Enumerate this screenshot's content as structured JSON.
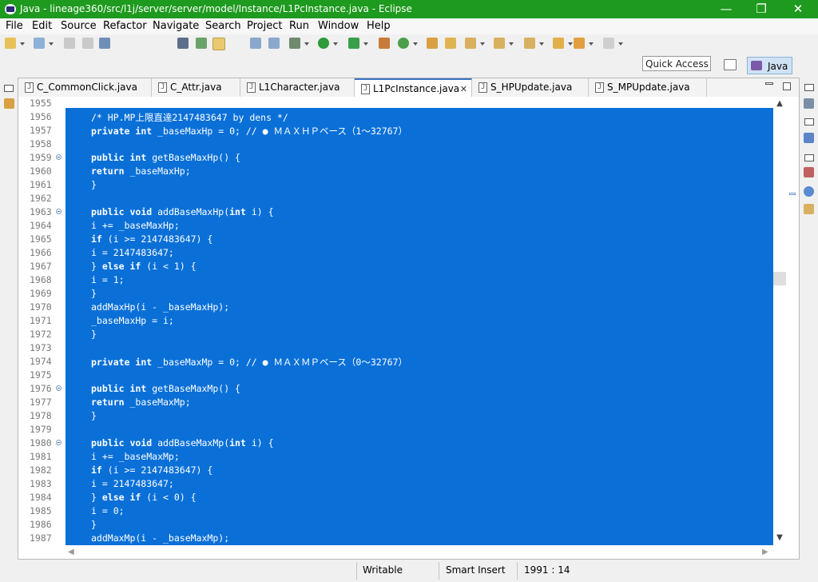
{
  "window": {
    "title": "Java - lineage360/src/l1j/server/server/model/Instance/L1PcInstance.java - Eclipse",
    "controls": [
      "—",
      "❐",
      "✕"
    ]
  },
  "menu": [
    "File",
    "Edit",
    "Source",
    "Refactor",
    "Navigate",
    "Search",
    "Project",
    "Run",
    "Window",
    "Help"
  ],
  "quick_access": {
    "placeholder": "Quick Access"
  },
  "perspective": {
    "active": "Java"
  },
  "tabs": [
    {
      "label": "C_CommonClick.java",
      "active": false
    },
    {
      "label": "C_Attr.java",
      "active": false
    },
    {
      "label": "L1Character.java",
      "active": false
    },
    {
      "label": "L1PcInstance.java",
      "active": true,
      "close": "✕"
    },
    {
      "label": "S_HPUpdate.java",
      "active": false
    },
    {
      "label": "S_MPUpdate.java",
      "active": false
    }
  ],
  "code": {
    "selection_color": "#0a70d8",
    "lines": [
      {
        "num": "1955",
        "text": ""
      },
      {
        "num": "1956",
        "text": "/* HP.MP上限直達2147483647 by dens */"
      },
      {
        "num": "1957",
        "text": "private int _baseMaxHp = 0; // ● ＭＡＸＨＰベース（1～32767）"
      },
      {
        "num": "1958",
        "text": ""
      },
      {
        "num": "1959",
        "text": "public int getBaseMaxHp() {"
      },
      {
        "num": "1960",
        "text": "return _baseMaxHp;"
      },
      {
        "num": "1961",
        "text": "}"
      },
      {
        "num": "1962",
        "text": ""
      },
      {
        "num": "1963",
        "text": "public void addBaseMaxHp(int i) {"
      },
      {
        "num": "1964",
        "text": "i += _baseMaxHp;"
      },
      {
        "num": "1965",
        "text": "if (i >= 2147483647) {"
      },
      {
        "num": "1966",
        "text": "i = 2147483647;"
      },
      {
        "num": "1967",
        "text": "} else if (i < 1) {"
      },
      {
        "num": "1968",
        "text": "i = 1;"
      },
      {
        "num": "1969",
        "text": "}"
      },
      {
        "num": "1970",
        "text": "addMaxHp(i - _baseMaxHp);"
      },
      {
        "num": "1971",
        "text": "_baseMaxHp = i;"
      },
      {
        "num": "1972",
        "text": "}"
      },
      {
        "num": "1973",
        "text": ""
      },
      {
        "num": "1974",
        "text": "private int _baseMaxMp = 0; // ● ＭＡＸＭＰベース（0～32767）"
      },
      {
        "num": "1975",
        "text": ""
      },
      {
        "num": "1976",
        "text": "public int getBaseMaxMp() {"
      },
      {
        "num": "1977",
        "text": "return _baseMaxMp;"
      },
      {
        "num": "1978",
        "text": "}"
      },
      {
        "num": "1979",
        "text": ""
      },
      {
        "num": "1980",
        "text": "public void addBaseMaxMp(int i) {"
      },
      {
        "num": "1981",
        "text": "i += _baseMaxMp;"
      },
      {
        "num": "1982",
        "text": "if (i >= 2147483647) {"
      },
      {
        "num": "1983",
        "text": "i = 2147483647;"
      },
      {
        "num": "1984",
        "text": "} else if (i < 0) {"
      },
      {
        "num": "1985",
        "text": "i = 0;"
      },
      {
        "num": "1986",
        "text": "}"
      },
      {
        "num": "1987",
        "text": "addMaxMp(i - _baseMaxMp);"
      }
    ]
  },
  "status": {
    "writable": "Writable",
    "insert_mode": "Smart Insert",
    "position": "1991 : 14"
  }
}
